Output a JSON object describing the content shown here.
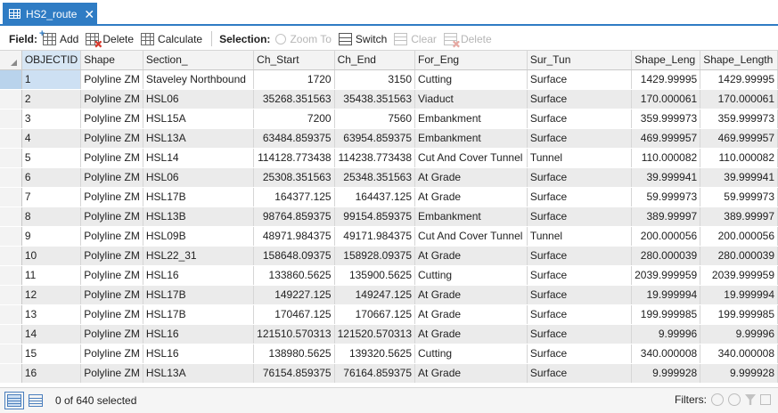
{
  "tab": {
    "title": "HS2_route",
    "close": "✕"
  },
  "toolbar": {
    "field_label": "Field:",
    "add": "Add",
    "delete": "Delete",
    "calculate": "Calculate",
    "selection_label": "Selection:",
    "zoom_to": "Zoom To",
    "switch": "Switch",
    "clear": "Clear",
    "sel_delete": "Delete"
  },
  "columns": [
    "OBJECTID",
    "Shape",
    "Section_",
    "Ch_Start",
    "Ch_End",
    "For_Eng",
    "Sur_Tun",
    "Shape_Leng",
    "Shape_Length"
  ],
  "rows": [
    [
      "1",
      "Polyline ZM",
      "Staveley Northbound",
      "1720",
      "3150",
      "Cutting",
      "Surface",
      "1429.99995",
      "1429.99995"
    ],
    [
      "2",
      "Polyline ZM",
      "HSL06",
      "35268.351563",
      "35438.351563",
      "Viaduct",
      "Surface",
      "170.000061",
      "170.000061"
    ],
    [
      "3",
      "Polyline ZM",
      "HSL15A",
      "7200",
      "7560",
      "Embankment",
      "Surface",
      "359.999973",
      "359.999973"
    ],
    [
      "4",
      "Polyline ZM",
      "HSL13A",
      "63484.859375",
      "63954.859375",
      "Embankment",
      "Surface",
      "469.999957",
      "469.999957"
    ],
    [
      "5",
      "Polyline ZM",
      "HSL14",
      "114128.773438",
      "114238.773438",
      "Cut And Cover Tunnel",
      "Tunnel",
      "110.000082",
      "110.000082"
    ],
    [
      "6",
      "Polyline ZM",
      "HSL06",
      "25308.351563",
      "25348.351563",
      "At Grade",
      "Surface",
      "39.999941",
      "39.999941"
    ],
    [
      "7",
      "Polyline ZM",
      "HSL17B",
      "164377.125",
      "164437.125",
      "At Grade",
      "Surface",
      "59.999973",
      "59.999973"
    ],
    [
      "8",
      "Polyline ZM",
      "HSL13B",
      "98764.859375",
      "99154.859375",
      "Embankment",
      "Surface",
      "389.99997",
      "389.99997"
    ],
    [
      "9",
      "Polyline ZM",
      "HSL09B",
      "48971.984375",
      "49171.984375",
      "Cut And Cover Tunnel",
      "Tunnel",
      "200.000056",
      "200.000056"
    ],
    [
      "10",
      "Polyline ZM",
      "HSL22_31",
      "158648.09375",
      "158928.09375",
      "At Grade",
      "Surface",
      "280.000039",
      "280.000039"
    ],
    [
      "11",
      "Polyline ZM",
      "HSL16",
      "133860.5625",
      "135900.5625",
      "Cutting",
      "Surface",
      "2039.999959",
      "2039.999959"
    ],
    [
      "12",
      "Polyline ZM",
      "HSL17B",
      "149227.125",
      "149247.125",
      "At Grade",
      "Surface",
      "19.999994",
      "19.999994"
    ],
    [
      "13",
      "Polyline ZM",
      "HSL17B",
      "170467.125",
      "170667.125",
      "At Grade",
      "Surface",
      "199.999985",
      "199.999985"
    ],
    [
      "14",
      "Polyline ZM",
      "HSL16",
      "121510.570313",
      "121520.570313",
      "At Grade",
      "Surface",
      "9.99996",
      "9.99996"
    ],
    [
      "15",
      "Polyline ZM",
      "HSL16",
      "138980.5625",
      "139320.5625",
      "Cutting",
      "Surface",
      "340.000008",
      "340.000008"
    ],
    [
      "16",
      "Polyline ZM",
      "HSL13A",
      "76154.859375",
      "76164.859375",
      "At Grade",
      "Surface",
      "9.999928",
      "9.999928"
    ]
  ],
  "status": {
    "selected_text": "0 of 640 selected",
    "filters_label": "Filters:"
  }
}
